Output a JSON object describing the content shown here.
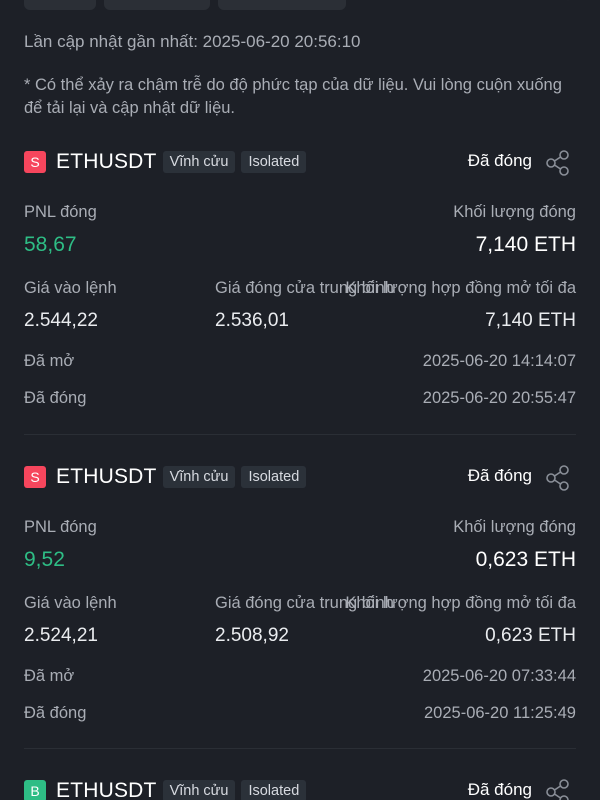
{
  "header": {
    "last_updated": "Lần cập nhật gần nhất: 2025-06-20 20:56:10",
    "note": "* Có thể xảy ra chậm trễ do độ phức tạp của dữ liệu. Vui lòng cuộn xuống để tải lại và cập nhật dữ liệu."
  },
  "labels": {
    "pnl_closed": "PNL đóng",
    "closed_volume": "Khối lượng đóng",
    "entry_price": "Giá vào lệnh",
    "avg_close_price": "Giá đóng cửa trung bình",
    "max_open_interest": "Khối lượng hợp đồng mở tối đa",
    "opened": "Đã mở",
    "closed": "Đã đóng"
  },
  "positions": [
    {
      "side": "S",
      "symbol": "ETHUSDT",
      "type_tag": "Vĩnh cửu",
      "margin_tag": "Isolated",
      "status": "Đã đóng",
      "pnl": "58,67",
      "closed_volume": "7,140 ETH",
      "entry_price": "2.544,22",
      "avg_close_price": "2.536,01",
      "max_open_interest": "7,140 ETH",
      "opened_time": "2025-06-20 14:14:07",
      "closed_time": "2025-06-20 20:55:47"
    },
    {
      "side": "S",
      "symbol": "ETHUSDT",
      "type_tag": "Vĩnh cửu",
      "margin_tag": "Isolated",
      "status": "Đã đóng",
      "pnl": "9,52",
      "closed_volume": "0,623 ETH",
      "entry_price": "2.524,21",
      "avg_close_price": "2.508,92",
      "max_open_interest": "0,623 ETH",
      "opened_time": "2025-06-20 07:33:44",
      "closed_time": "2025-06-20 11:25:49"
    },
    {
      "side": "B",
      "symbol": "ETHUSDT",
      "type_tag": "Vĩnh cửu",
      "margin_tag": "Isolated",
      "status": "Đã đóng"
    }
  ],
  "colors": {
    "background": "#1d2027",
    "sell": "#f6465d",
    "buy": "#2ebd85",
    "pnl_positive": "#2ebd85",
    "muted_text": "#a9adb5"
  },
  "icons": [
    "share-icon",
    "chevron-down-icon"
  ]
}
